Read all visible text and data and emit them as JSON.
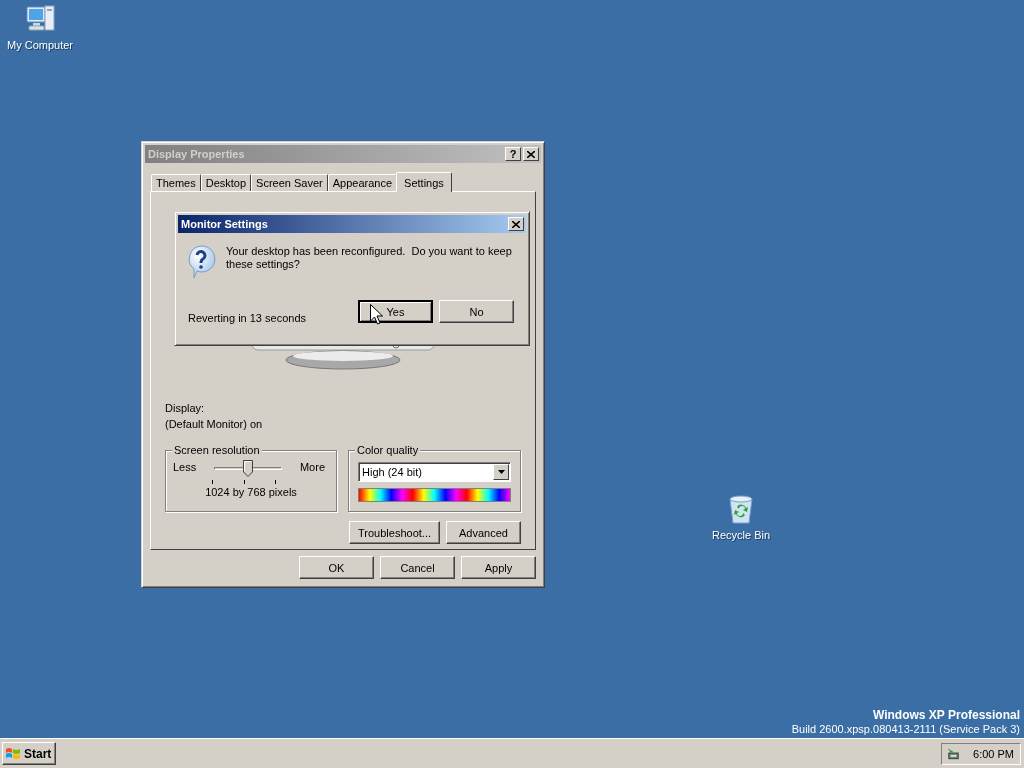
{
  "desktop_icons": [
    {
      "label": "My Computer",
      "kind": "computer"
    },
    {
      "label": "Recycle Bin",
      "kind": "recycle"
    }
  ],
  "window": {
    "title": "Display Properties",
    "active": false,
    "help_button": "?",
    "tabs": [
      {
        "label": "Themes",
        "selected": false
      },
      {
        "label": "Desktop",
        "selected": false
      },
      {
        "label": "Screen Saver",
        "selected": false
      },
      {
        "label": "Appearance",
        "selected": false
      },
      {
        "label": "Settings",
        "selected": true
      }
    ],
    "display_label": "Display:",
    "display_value": "(Default Monitor) on",
    "resolution": {
      "title": "Screen resolution",
      "less": "Less",
      "more": "More",
      "level": 0.5,
      "reading": "1024 by 768 pixels"
    },
    "color_quality": {
      "title": "Color quality",
      "value": "High (24 bit)"
    },
    "panel_buttons": [
      "Troubleshoot...",
      "Advanced"
    ],
    "buttons": [
      "OK",
      "Cancel",
      "Apply"
    ]
  },
  "dialog": {
    "title": "Monitor Settings",
    "active": true,
    "message": "Your desktop has been reconfigured.  Do you want to keep these settings?",
    "countdown": "Reverting in 13 seconds",
    "buttons": [
      {
        "label": "Yes",
        "default": true
      },
      {
        "label": "No",
        "default": false
      }
    ]
  },
  "branding": {
    "edition": "Windows XP Professional",
    "build": "Build 2600.xpsp.080413-2111 (Service Pack 3)"
  },
  "taskbar": {
    "start": "Start",
    "clock": "6:00 PM"
  }
}
